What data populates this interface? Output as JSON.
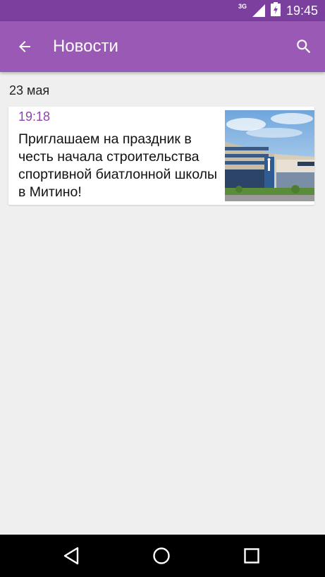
{
  "status_bar": {
    "network": "3G",
    "time": "19:45"
  },
  "app_bar": {
    "title": "Новости",
    "back_icon": "arrow-left-icon",
    "search_icon": "search-icon"
  },
  "news": {
    "date_header": "23 мая",
    "items": [
      {
        "time": "19:18",
        "text": "Приглашаем на праздник в честь начала строительства спортивной биатлонной школы в Митино!",
        "thumbnail": "building-photo"
      }
    ]
  },
  "nav_bar": {
    "back_icon": "triangle-back-icon",
    "home_icon": "circle-home-icon",
    "recents_icon": "square-recents-icon"
  },
  "colors": {
    "status_bar": "#7b3f9e",
    "app_bar": "#9b59b6",
    "accent_time": "#8e44ad",
    "background": "#efefef"
  }
}
